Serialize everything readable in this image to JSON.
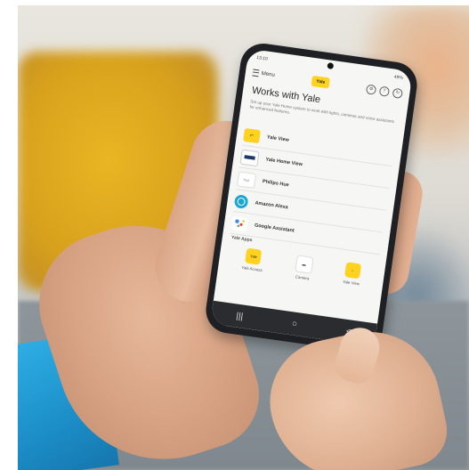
{
  "phone": {
    "status_time": "13:10",
    "status_right": "49%",
    "menu_label": "Menu",
    "logo_text": "Yale",
    "top_icons": [
      "gear-icon",
      "help-icon",
      "sync-icon"
    ],
    "title": "Works with Yale",
    "subtitle": "Set up your Yale Home system to work with lights, cameras and voice assistants for enhanced features.",
    "integrations": [
      {
        "label": "Yale View",
        "icon": "yale-view-icon"
      },
      {
        "label": "Yale Home View",
        "icon": "yale-home-view-icon"
      },
      {
        "label": "Philips Hue",
        "icon": "philips-hue-icon"
      },
      {
        "label": "Amazon Alexa",
        "icon": "alexa-icon"
      },
      {
        "label": "Google Assistant",
        "icon": "google-assistant-icon"
      }
    ],
    "apps_section_label": "Yale Apps",
    "apps": [
      {
        "label": "Yale Access"
      },
      {
        "label": "Camera"
      },
      {
        "label": "Yale View"
      }
    ],
    "nav": [
      "|||",
      "○",
      "<"
    ]
  },
  "colors": {
    "yale_yellow": "#ffd21f",
    "sleeve_blue": "#1c8ec8",
    "phone_body": "#1e2024"
  }
}
